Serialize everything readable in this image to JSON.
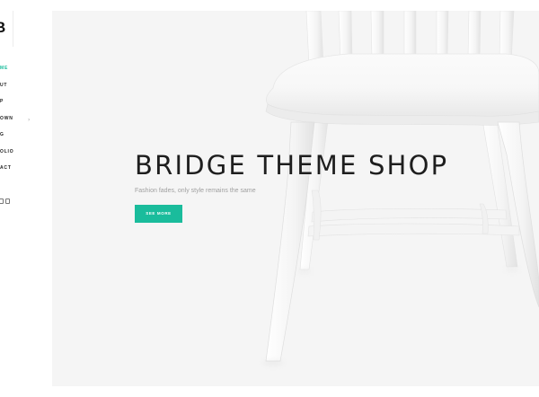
{
  "logo": {
    "text": "B"
  },
  "nav": {
    "items": [
      {
        "label": "HOME",
        "visible_text": "ME",
        "active": true
      },
      {
        "label": "ABOUT",
        "visible_text": "UT",
        "active": false
      },
      {
        "label": "SHOP",
        "visible_text": "P",
        "active": false
      },
      {
        "label": "DROPDOWN",
        "visible_text": "OWN",
        "active": false,
        "has_dropdown": true
      },
      {
        "label": "BLOG",
        "visible_text": "G",
        "active": false
      },
      {
        "label": "PORTFOLIO",
        "visible_text": "OLIO",
        "active": false
      },
      {
        "label": "CONTACT",
        "visible_text": "ACT",
        "active": false
      }
    ]
  },
  "social": {
    "icons": [
      "social-icon",
      "instagram-icon"
    ]
  },
  "hero": {
    "title": "BRIDGE THEME SHOP",
    "subtitle": "Fashion fades, only style remains the same",
    "button_label": "SEE MORE"
  },
  "colors": {
    "accent": "#1abc9c",
    "hero_bg": "#f5f5f5",
    "text": "#1e1e1e"
  }
}
